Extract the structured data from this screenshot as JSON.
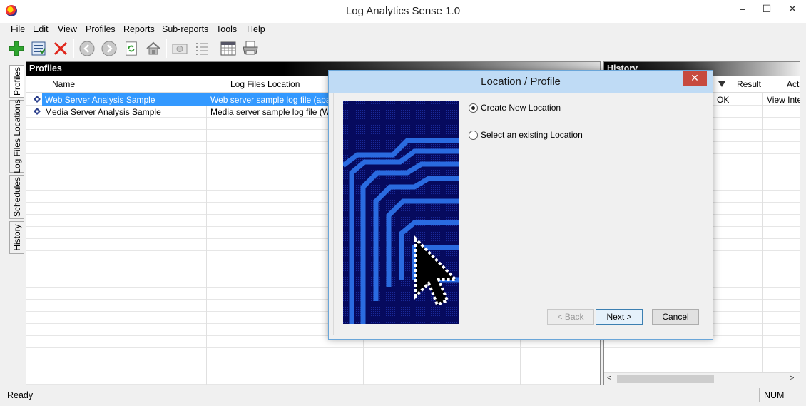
{
  "window": {
    "title": "Log Analytics Sense 1.0",
    "min": "–",
    "max": "☐",
    "close": "✕"
  },
  "menu": [
    "File",
    "Edit",
    "View",
    "Profiles",
    "Reports",
    "Sub-reports",
    "Tools",
    "Help"
  ],
  "toolbar_icons": [
    "add-icon",
    "properties-icon",
    "delete-icon",
    "back-icon",
    "forward-icon",
    "refresh-icon",
    "home-icon",
    "preview-icon",
    "list-icon",
    "calendar-icon",
    "print-icon"
  ],
  "side_tabs": [
    "Profiles",
    "Log Files Locations",
    "Schedules",
    "History"
  ],
  "profiles": {
    "header": "Profiles",
    "columns": [
      "Name",
      "Log Files Location"
    ],
    "rows": [
      {
        "name": "Web Server Analysis Sample",
        "location": "Web server sample log file (apache)",
        "selected": true
      },
      {
        "name": "Media Server Analysis Sample",
        "location": "Media server sample log file (WMS)",
        "selected": false
      }
    ]
  },
  "history": {
    "header": "History",
    "columns": [
      "Result",
      "Act"
    ],
    "rows": [
      {
        "result": "OK",
        "action": "View Inte"
      }
    ]
  },
  "status": {
    "text": "Ready",
    "num": "NUM"
  },
  "dialog": {
    "title": "Location / Profile",
    "close": "✕",
    "options": [
      {
        "label": "Create New Location",
        "checked": true
      },
      {
        "label": "Select an existing Location",
        "checked": false
      }
    ],
    "buttons": {
      "back": "< Back",
      "next": "Next >",
      "cancel": "Cancel"
    }
  },
  "colors": {
    "selection": "#3399ff",
    "dialog_title": "#bfdbf5",
    "close_button": "#c74a3f",
    "wizard_bg": "#060a5e",
    "wizard_lines": "#2a6be0"
  }
}
